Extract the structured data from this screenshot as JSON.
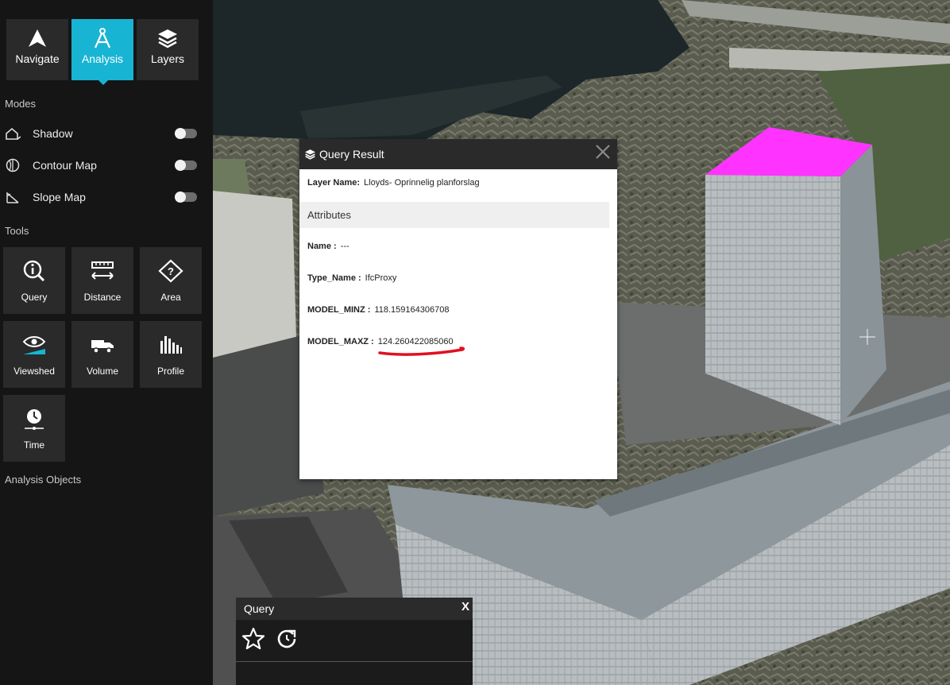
{
  "nav_tabs": [
    {
      "label": "Navigate",
      "icon": "navigate-arrow-icon"
    },
    {
      "label": "Analysis",
      "icon": "compass-icon",
      "active": true
    },
    {
      "label": "Layers",
      "icon": "layers-icon"
    }
  ],
  "modes": {
    "heading": "Modes",
    "items": [
      {
        "label": "Shadow",
        "icon": "house-shadow-icon",
        "enabled": false
      },
      {
        "label": "Contour Map",
        "icon": "contour-globe-icon",
        "enabled": false
      },
      {
        "label": "Slope Map",
        "icon": "slope-icon",
        "enabled": false
      }
    ]
  },
  "tools": {
    "heading": "Tools",
    "items": [
      {
        "label": "Query",
        "icon": "query-info-icon"
      },
      {
        "label": "Distance",
        "icon": "ruler-icon"
      },
      {
        "label": "Area",
        "icon": "area-diamond-icon"
      },
      {
        "label": "Viewshed",
        "icon": "eye-icon"
      },
      {
        "label": "Volume",
        "icon": "truck-icon"
      },
      {
        "label": "Profile",
        "icon": "profile-bars-icon"
      },
      {
        "label": "Time",
        "icon": "clock-icon"
      }
    ]
  },
  "analysis_objects": {
    "heading": "Analysis Objects"
  },
  "query_result": {
    "title": "Query Result",
    "layer_name_label": "Layer Name:",
    "layer_name_value": "Lloyds- Oprinnelig planforslag",
    "attributes_heading": "Attributes",
    "attributes": [
      {
        "key": "Name :",
        "value": "---"
      },
      {
        "key": "Type_Name :",
        "value": "IfcProxy"
      },
      {
        "key": "MODEL_MINZ :",
        "value": "118.159164306708"
      },
      {
        "key": "MODEL_MAXZ :",
        "value": "124.260422085060"
      }
    ],
    "highlight_color": "#e01020"
  },
  "query_panel": {
    "title": "Query",
    "close_label": "X"
  },
  "colors": {
    "accent": "#18b4d3",
    "sidebar_bg": "#151515",
    "tile_bg": "#2a2a2a",
    "selection_magenta": "#ff33ff"
  }
}
